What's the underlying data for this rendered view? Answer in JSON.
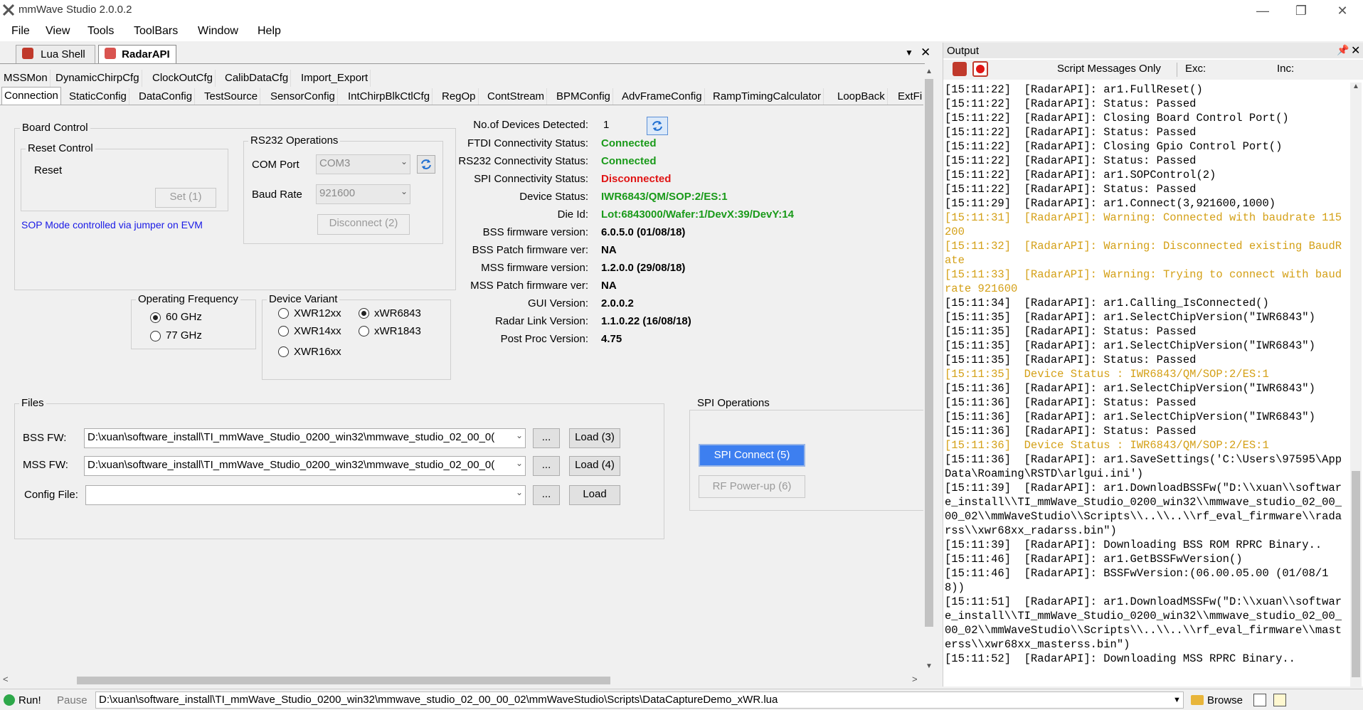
{
  "window": {
    "title": "mmWave Studio 2.0.0.2"
  },
  "menu": [
    "File",
    "View",
    "Tools",
    "ToolBars",
    "Window",
    "Help"
  ],
  "doc_tabs": [
    {
      "label": "Lua Shell"
    },
    {
      "label": "RadarAPI"
    }
  ],
  "tabs_row1": [
    "MSSMon",
    "DynamicChirpCfg",
    "ClockOutCfg",
    "CalibDataCfg",
    "Import_Export"
  ],
  "tabs_row2": [
    "Connection",
    "StaticConfig",
    "DataConfig",
    "TestSource",
    "SensorConfig",
    "IntChirpBlkCtlCfg",
    "RegOp",
    "ContStream",
    "BPMConfig",
    "AdvFrameConfig",
    "RampTimingCalculator",
    "LoopBack",
    "ExtFi"
  ],
  "board_control": {
    "title": "Board Control",
    "reset_control": "Reset Control",
    "reset_label": "Reset",
    "set_button": "Set (1)",
    "sop_note": "SOP Mode controlled via jumper on EVM"
  },
  "rs232": {
    "title": "RS232 Operations",
    "com_port_label": "COM Port",
    "com_port_value": "COM3",
    "baud_label": "Baud Rate",
    "baud_value": "921600",
    "disconnect_button": "Disconnect (2)"
  },
  "op_freq": {
    "title": "Operating Frequency",
    "opt1": "60 GHz",
    "opt2": "77 GHz"
  },
  "device_variant": {
    "title": "Device Variant",
    "v1": "XWR12xx",
    "v2": "xWR6843",
    "v3": "XWR14xx",
    "v4": "xWR1843",
    "v5": "XWR16xx"
  },
  "status": {
    "devices_label": "No.of Devices Detected:",
    "devices_value": "1",
    "ftdi_label": "FTDI Connectivity Status:",
    "ftdi_value": "Connected",
    "rs232_label": "RS232 Connectivity Status:",
    "rs232_value": "Connected",
    "spi_label": "SPI Connectivity Status:",
    "spi_value": "Disconnected",
    "device_status_label": "Device Status:",
    "device_status_value": "IWR6843/QM/SOP:2/ES:1",
    "die_id_label": "Die Id:",
    "die_id_value": "Lot:6843000/Wafer:1/DevX:39/DevY:14",
    "bss_fw_label": "BSS firmware version:",
    "bss_fw_value": "6.0.5.0 (01/08/18)",
    "bss_patch_label": "BSS Patch firmware ver:",
    "bss_patch_value": "NA",
    "mss_fw_label": "MSS firmware version:",
    "mss_fw_value": "1.2.0.0 (29/08/18)",
    "mss_patch_label": "MSS Patch firmware ver:",
    "mss_patch_value": "NA",
    "gui_label": "GUI Version:",
    "gui_value": "2.0.0.2",
    "rlink_label": "Radar Link Version:",
    "rlink_value": "1.1.0.22 (16/08/18)",
    "postproc_label": "Post Proc Version:",
    "postproc_value": "4.75"
  },
  "files": {
    "title": "Files",
    "bss_label": "BSS FW:",
    "bss_path": "D:\\xuan\\software_install\\TI_mmWave_Studio_0200_win32\\mmwave_studio_02_00_0(",
    "bss_load": "Load (3)",
    "mss_label": "MSS FW:",
    "mss_path": "D:\\xuan\\software_install\\TI_mmWave_Studio_0200_win32\\mmwave_studio_02_00_0(",
    "mss_load": "Load (4)",
    "cfg_label": "Config File:",
    "cfg_path": "",
    "cfg_load": "Load",
    "browse": "..."
  },
  "spi": {
    "title": "SPI Operations",
    "connect": "SPI Connect (5)",
    "rf_power": "RF Power-up (6)"
  },
  "output": {
    "title": "Output",
    "script_msgs": "Script Messages Only",
    "exc": "Exc:",
    "inc": "Inc:",
    "lines": [
      {
        "t": "[15:11:22]  [RadarAPI]: ar1.FullReset()",
        "c": "n"
      },
      {
        "t": "[15:11:22]  [RadarAPI]: Status: Passed",
        "c": "n"
      },
      {
        "t": "[15:11:22]  [RadarAPI]: Closing Board Control Port()",
        "c": "n"
      },
      {
        "t": "[15:11:22]  [RadarAPI]: Status: Passed",
        "c": "n"
      },
      {
        "t": "[15:11:22]  [RadarAPI]: Closing Gpio Control Port()",
        "c": "n"
      },
      {
        "t": "[15:11:22]  [RadarAPI]: Status: Passed",
        "c": "n"
      },
      {
        "t": "[15:11:22]  [RadarAPI]: ar1.SOPControl(2)",
        "c": "n"
      },
      {
        "t": "[15:11:22]  [RadarAPI]: Status: Passed",
        "c": "n"
      },
      {
        "t": "[15:11:29]  [RadarAPI]: ar1.Connect(3,921600,1000)",
        "c": "n"
      },
      {
        "t": "[15:11:31]  [RadarAPI]: Warning: Connected with baudrate 115200",
        "c": "w"
      },
      {
        "t": "[15:11:32]  [RadarAPI]: Warning: Disconnected existing BaudRate",
        "c": "w"
      },
      {
        "t": "[15:11:33]  [RadarAPI]: Warning: Trying to connect with baudrate 921600",
        "c": "w"
      },
      {
        "t": "[15:11:34]  [RadarAPI]: ar1.Calling_IsConnected()",
        "c": "n"
      },
      {
        "t": "[15:11:35]  [RadarAPI]: ar1.SelectChipVersion(\"IWR6843\")",
        "c": "n"
      },
      {
        "t": "[15:11:35]  [RadarAPI]: Status: Passed",
        "c": "n"
      },
      {
        "t": "[15:11:35]  [RadarAPI]: ar1.SelectChipVersion(\"IWR6843\")",
        "c": "n"
      },
      {
        "t": "[15:11:35]  [RadarAPI]: Status: Passed",
        "c": "n"
      },
      {
        "t": "[15:11:35]  Device Status : IWR6843/QM/SOP:2/ES:1",
        "c": "w"
      },
      {
        "t": "[15:11:36]  [RadarAPI]: ar1.SelectChipVersion(\"IWR6843\")",
        "c": "n"
      },
      {
        "t": "[15:11:36]  [RadarAPI]: Status: Passed",
        "c": "n"
      },
      {
        "t": "[15:11:36]  [RadarAPI]: ar1.SelectChipVersion(\"IWR6843\")",
        "c": "n"
      },
      {
        "t": "[15:11:36]  [RadarAPI]: Status: Passed",
        "c": "n"
      },
      {
        "t": "[15:11:36]  Device Status : IWR6843/QM/SOP:2/ES:1",
        "c": "w"
      },
      {
        "t": "[15:11:36]  [RadarAPI]: ar1.SaveSettings('C:\\Users\\97595\\AppData\\Roaming\\RSTD\\arlgui.ini')",
        "c": "n"
      },
      {
        "t": "[15:11:39]  [RadarAPI]: ar1.DownloadBSSFw(\"D:\\\\xuan\\\\software_install\\\\TI_mmWave_Studio_0200_win32\\\\mmwave_studio_02_00_00_02\\\\mmWaveStudio\\\\Scripts\\\\..\\\\..\\\\rf_eval_firmware\\\\radarss\\\\xwr68xx_radarss.bin\")",
        "c": "n"
      },
      {
        "t": "[15:11:39]  [RadarAPI]: Downloading BSS ROM RPRC Binary..",
        "c": "n"
      },
      {
        "t": "[15:11:46]  [RadarAPI]: ar1.GetBSSFwVersion()",
        "c": "n"
      },
      {
        "t": "[15:11:46]  [RadarAPI]: BSSFwVersion:(06.00.05.00 (01/08/18))",
        "c": "n"
      },
      {
        "t": "[15:11:51]  [RadarAPI]: ar1.DownloadMSSFw(\"D:\\\\xuan\\\\software_install\\\\TI_mmWave_Studio_0200_win32\\\\mmwave_studio_02_00_00_02\\\\mmWaveStudio\\\\Scripts\\\\..\\\\..\\\\rf_eval_firmware\\\\masterss\\\\xwr68xx_masterss.bin\")",
        "c": "n"
      },
      {
        "t": "[15:11:52]  [RadarAPI]: Downloading MSS RPRC Binary..",
        "c": "n"
      }
    ]
  },
  "statusbar": {
    "run": "Run!",
    "pause": "Pause",
    "script_path": "D:\\xuan\\software_install\\TI_mmWave_Studio_0200_win32\\mmwave_studio_02_00_00_02\\mmWaveStudio\\Scripts\\DataCaptureDemo_xWR.lua",
    "browse": "Browse"
  },
  "colors": {
    "connected": "#1a9a1a",
    "disconnected": "#e01515",
    "warning": "#d4a017",
    "spi_button": "#3d7ff0"
  }
}
